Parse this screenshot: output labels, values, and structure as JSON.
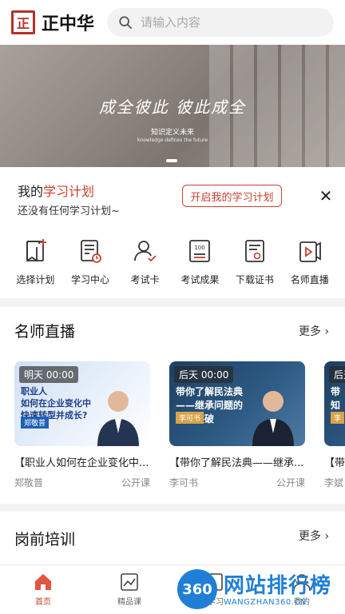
{
  "header": {
    "logo_glyph": "正",
    "app_name": "正中华",
    "search_placeholder": "请输入内容"
  },
  "banner": {
    "headline": "成全彼此  彼此成全",
    "subtitle": "知识定义未来",
    "subtitle_en": "knowledge defines the future"
  },
  "plan": {
    "title_prefix": "我的",
    "title_highlight": "学习计划",
    "subtitle": "还没有任何学习计划~",
    "button": "开启我的学习计划",
    "close": "✕"
  },
  "actions": [
    {
      "label": "选择计划",
      "icon": "plan-add-icon"
    },
    {
      "label": "学习中心",
      "icon": "study-center-icon"
    },
    {
      "label": "考试卡",
      "icon": "exam-card-icon"
    },
    {
      "label": "考试成果",
      "icon": "exam-result-icon"
    },
    {
      "label": "下载证书",
      "icon": "certificate-icon"
    },
    {
      "label": "名师直播",
      "icon": "live-icon"
    }
  ],
  "live_section": {
    "title": "名师直播",
    "more": "更多",
    "cards": [
      {
        "time_tag": "明天 00:00",
        "thumb_line1": "职业人",
        "thumb_line2": "如何在企业变化中",
        "thumb_line3": "快速转型并成长?",
        "thumb_name": "郑敬普",
        "title": "【职业人如何在企业变化中...",
        "teacher": "郑敬普",
        "type": "公开课"
      },
      {
        "time_tag": "后天 00:00",
        "thumb_line1": "带你了解民法典",
        "thumb_line2": "——继承问题的",
        "thumb_line3": "重大突破",
        "thumb_name": "李可书",
        "title": "【带你了解民法典——继承...",
        "teacher": "李可书",
        "type": "公开课"
      },
      {
        "time_tag": "后天",
        "thumb_line1": "带",
        "thumb_line2": "知",
        "thumb_line3": "",
        "thumb_name": "李",
        "title": "【带",
        "teacher": "李斌",
        "type": ""
      }
    ]
  },
  "training_section": {
    "title": "岗前培训",
    "more": "更多"
  },
  "tabbar": [
    {
      "label": "首页",
      "icon": "home-icon",
      "active": true
    },
    {
      "label": "精品课",
      "icon": "course-icon",
      "active": false
    },
    {
      "label": "学习",
      "icon": "study-icon",
      "active": false
    },
    {
      "label": "我的",
      "icon": "profile-icon",
      "active": false
    }
  ],
  "watermark": {
    "badge": "360",
    "text": "网站排行榜",
    "url": "WANGZHAN360.CN"
  },
  "colors": {
    "accent": "#c6402e",
    "watermark": "#1f7fd6"
  }
}
